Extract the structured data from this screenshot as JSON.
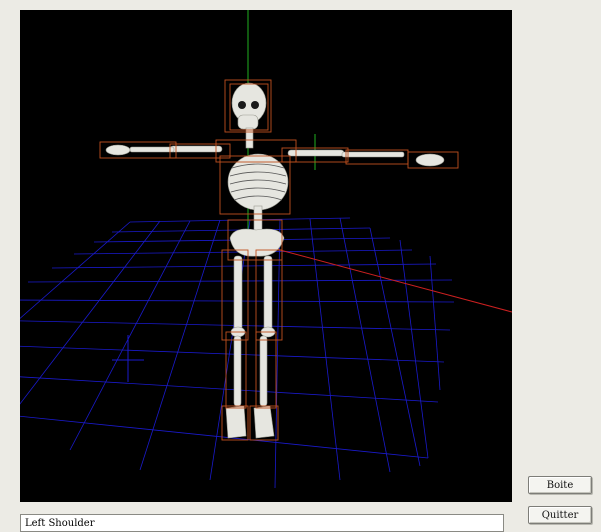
{
  "viewport": {
    "scene_name": "skeleton-3d-scene",
    "background_color": "#000000",
    "grid_color": "#1a1acc",
    "x_axis_color": "#cc2020",
    "y_axis_color": "#20b020",
    "bounding_box_color": "#c0501e",
    "bone_color": "#e6e6e0"
  },
  "buttons": {
    "boite_label": "Boite",
    "quit_label": "Quitter"
  },
  "status": {
    "selected_bone": "Left Shoulder"
  }
}
